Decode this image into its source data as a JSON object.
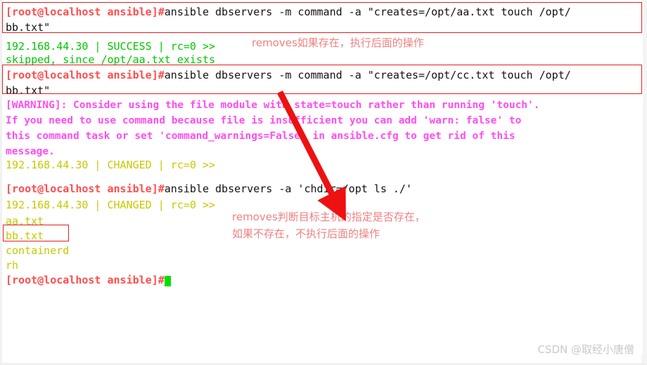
{
  "terminal": {
    "colors": {
      "prompt": "#ff4d4d",
      "command": "#111111",
      "success": "#00c700",
      "changed": "#c8c800",
      "warning": "#ff4df0",
      "annotation": "#f08080",
      "box": "#e02020",
      "cursor": "#00e000",
      "background": "#ffffff"
    },
    "prompt_text": "[root@localhost ansible]#",
    "lines": [
      {
        "id": "cmd1a",
        "prompt": "[root@localhost ansible]#",
        "command": "ansible dbservers -m command -a \"creates=/opt/aa.txt touch /opt/"
      },
      {
        "id": "cmd1b",
        "command": "bb.txt\""
      },
      {
        "id": "out1a",
        "text": "192.168.44.30 | SUCCESS | rc=0 >>"
      },
      {
        "id": "out1b",
        "text": "skipped, since /opt/aa.txt exists"
      },
      {
        "id": "cmd2a",
        "prompt": "[root@localhost ansible]#",
        "command": "ansible dbservers -m command -a \"creates=/opt/cc.txt touch /opt/"
      },
      {
        "id": "cmd2b",
        "command": "bb.txt\""
      },
      {
        "id": "warn1",
        "text": "[WARNING]: Consider using the file module with state=touch rather than running 'touch'."
      },
      {
        "id": "warn2",
        "text": "If you need to use command because file is insufficient you can add 'warn: false' to"
      },
      {
        "id": "warn3",
        "text": "this command task or set 'command_warnings=False' in ansible.cfg to get rid of this"
      },
      {
        "id": "warn4",
        "text": "message."
      },
      {
        "id": "out2",
        "text": "192.168.44.30 | CHANGED | rc=0 >>"
      },
      {
        "id": "cmd3",
        "prompt": "[root@localhost ansible]#",
        "command": "ansible dbservers -a 'chdir=/opt ls ./'"
      },
      {
        "id": "out3",
        "text": "192.168.44.30 | CHANGED | rc=0 >>"
      },
      {
        "id": "file1",
        "text": "aa.txt"
      },
      {
        "id": "file2",
        "text": "bb.txt"
      },
      {
        "id": "file3",
        "text": "containerd"
      },
      {
        "id": "file4",
        "text": "rh"
      },
      {
        "id": "cmd4",
        "prompt": "[root@localhost ansible]#",
        "command": ""
      }
    ]
  },
  "annotations": {
    "note1": "removes如果存在，执行后面的操作",
    "note2_line1": "removes判断目标主机的指定是否存在，",
    "note2_line2": "如果不存在，不执行后面的操作"
  },
  "watermark": {
    "text": "CSDN @取经小唐僧"
  }
}
